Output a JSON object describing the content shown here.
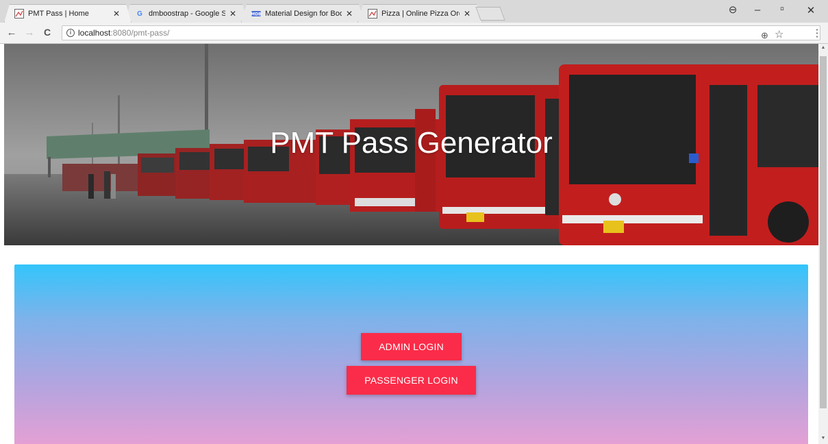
{
  "tabs": [
    {
      "title": "PMT Pass | Home",
      "icon": "pmt-favicon",
      "active": true
    },
    {
      "title": "dmboostrap - Google Se",
      "icon": "google-favicon",
      "active": false
    },
    {
      "title": "Material Design for Boot",
      "icon": "mdb-favicon",
      "active": false
    },
    {
      "title": "Pizza | Online Pizza Order",
      "icon": "pizza-favicon",
      "active": false
    }
  ],
  "browser": {
    "url_host": "localhost",
    "url_path": ":8080/pmt-pass/",
    "back_icon": "←",
    "forward_icon": "→",
    "reload_icon": "C",
    "zoom_icon": "⊕",
    "star_icon": "☆",
    "menu_icon": "⋮",
    "account_icon": "⊖",
    "minimize_icon": "–",
    "restore_icon": "▫",
    "close_icon": "✕",
    "tab_close_icon": "✕"
  },
  "hero": {
    "title": "PMT Pass Generator"
  },
  "login": {
    "admin_label": "ADMIN LOGIN",
    "passenger_label": "PASSENGER LOGIN"
  },
  "colors": {
    "button": "#fb2c49",
    "gradient_top": "#33c5fb",
    "gradient_bottom": "#e8a0d3"
  }
}
